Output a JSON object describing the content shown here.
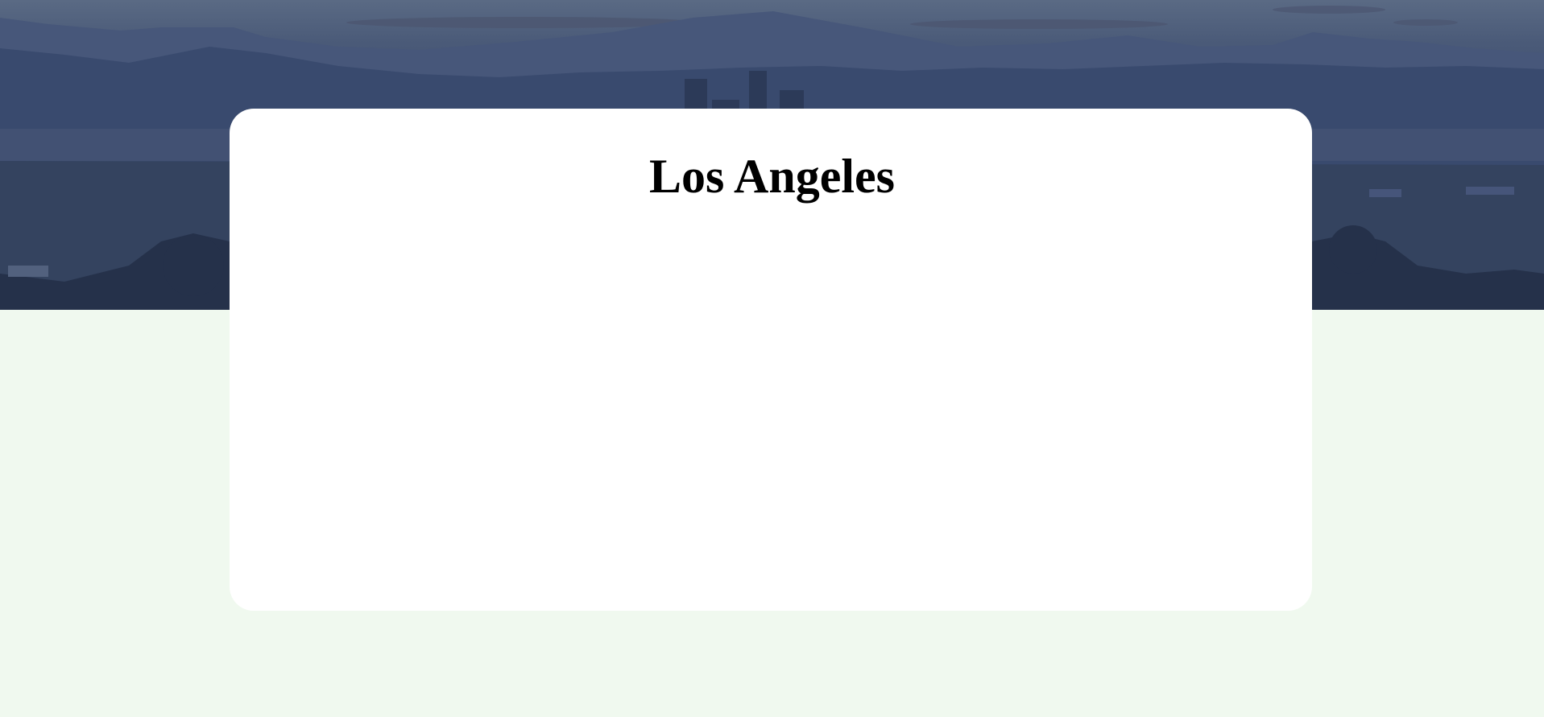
{
  "city": {
    "name": "Los Angeles"
  },
  "hero": {
    "image": "los-angeles-skyline-mountains-photo",
    "overlay_color": "#36466a"
  },
  "colors": {
    "page_background": "#f0f9ef",
    "card_background": "#ffffff",
    "title_text": "#000000"
  }
}
